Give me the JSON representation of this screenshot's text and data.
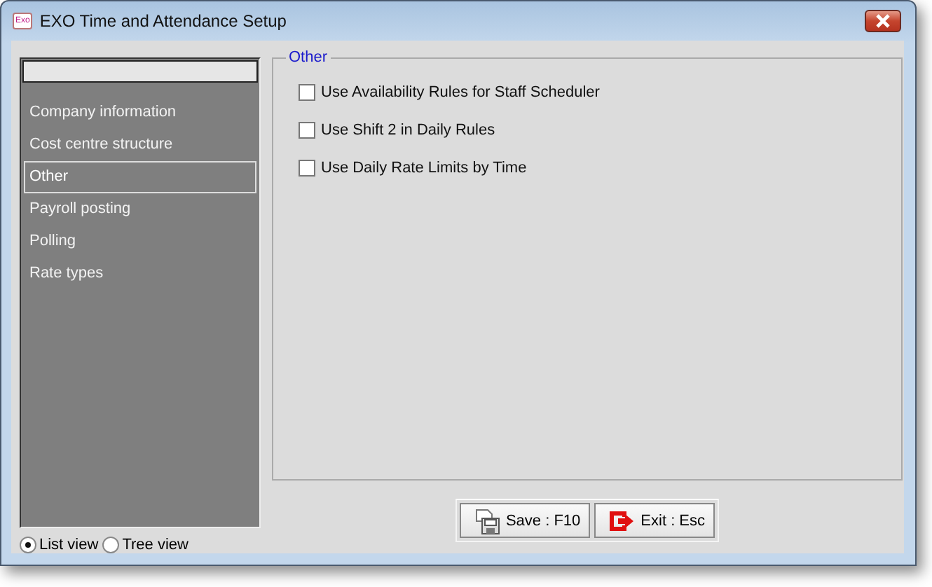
{
  "window": {
    "title": "EXO Time and Attendance Setup",
    "app_icon_text": "Exo"
  },
  "sidebar": {
    "items": [
      {
        "label": "Company information",
        "selected": false
      },
      {
        "label": "Cost centre structure",
        "selected": false
      },
      {
        "label": "Other",
        "selected": true
      },
      {
        "label": "Payroll posting",
        "selected": false
      },
      {
        "label": "Polling",
        "selected": false
      },
      {
        "label": "Rate types",
        "selected": false
      }
    ]
  },
  "group": {
    "title": "Other",
    "options": [
      {
        "label": "Use Availability Rules for Staff Scheduler",
        "checked": false
      },
      {
        "label": "Use Shift 2 in Daily Rules",
        "checked": false
      },
      {
        "label": "Use Daily Rate Limits by Time",
        "checked": false
      }
    ]
  },
  "buttons": [
    {
      "label": "Save : F10",
      "kind": "save"
    },
    {
      "label": "Exit : Esc",
      "kind": "exit"
    }
  ],
  "view_options": [
    {
      "label": "List view",
      "selected": true
    },
    {
      "label": "Tree view",
      "selected": false
    }
  ]
}
